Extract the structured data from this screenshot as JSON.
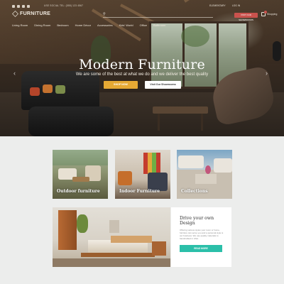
{
  "header": {
    "phone": "USE SOCIAL TEL: (555) 123 4567",
    "logo": "FURNITURE",
    "search": {
      "placeholder": ""
    },
    "account_links": [
      "ELEMENTARY",
      "LOG IN"
    ],
    "cta": "VISIT OUR SHOWROOMS",
    "cart_label": "Shopping"
  },
  "nav": [
    "Living Room",
    "Dining Room",
    "Bedroom",
    "Home Décor",
    "Accessories",
    "Kids' World",
    "Office",
    "Bathroom"
  ],
  "hero": {
    "title": "Modern Furniture",
    "subtitle": "We are some of the best at what we do and we deliver the best quality",
    "shop_button": "SHOP NOW",
    "show_button": "Visit Our Showrooms",
    "prev_arrow": "‹",
    "next_arrow": "›"
  },
  "categories": [
    {
      "label": "Outdoor furniture"
    },
    {
      "label": "Indoor Furniture"
    },
    {
      "label": "Collections"
    }
  ],
  "feature": {
    "title": "Drive your own Design",
    "body": "Offering various styles your room or home, furniture can serve you and a personal style is our business. We use quality materials to handcrafted in USA.",
    "button": "READ MORE"
  },
  "colors": {
    "accent_gold": "#e6a934",
    "accent_teal": "#2bbfa9",
    "accent_red": "#c9524d"
  }
}
